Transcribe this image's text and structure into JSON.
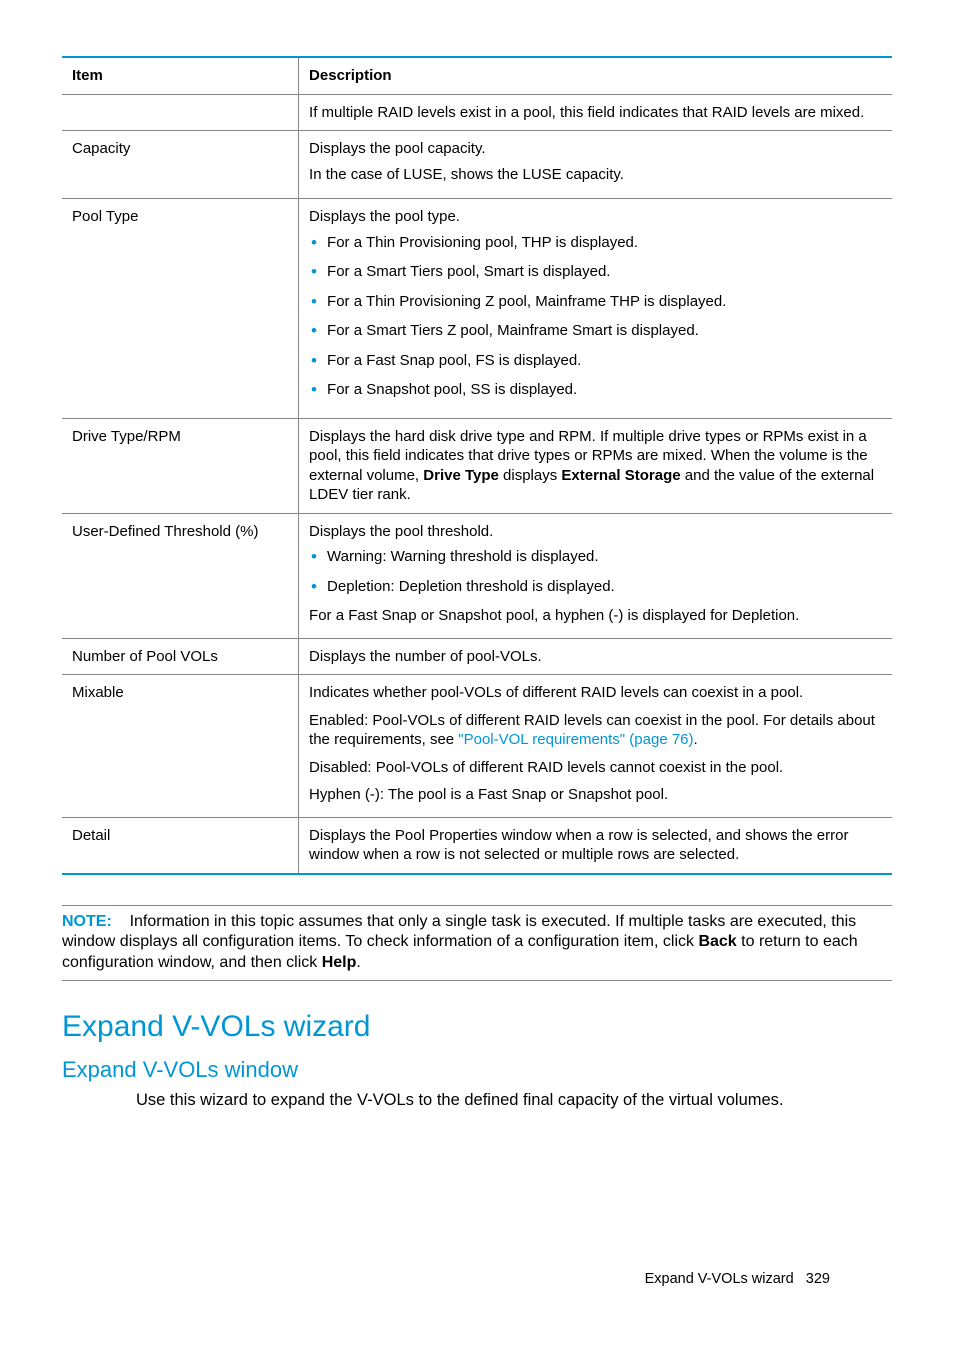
{
  "table": {
    "headers": {
      "item": "Item",
      "description": "Description"
    },
    "rows": {
      "raid_note": "If multiple RAID levels exist in a pool, this field indicates that RAID levels are mixed.",
      "capacity": {
        "item": "Capacity",
        "l1": "Displays the pool capacity.",
        "l2": "In the case of LUSE, shows the LUSE capacity."
      },
      "pool_type": {
        "item": "Pool Type",
        "lead": "Displays the pool type.",
        "bullets": [
          "For a Thin Provisioning pool, THP is displayed.",
          "For a Smart Tiers pool, Smart is displayed.",
          "For a Thin Provisioning Z pool, Mainframe THP is displayed.",
          "For a Smart Tiers Z pool, Mainframe Smart is displayed.",
          "For a Fast Snap pool, FS is displayed.",
          "For a Snapshot pool, SS is displayed."
        ]
      },
      "drive": {
        "item": "Drive Type/RPM",
        "t1": "Displays the hard disk drive type and RPM. If multiple drive types or RPMs exist in a pool, this field indicates that drive types or RPMs are mixed. When the volume is the external volume, ",
        "b1": "Drive Type",
        "t2": " displays ",
        "b2": "External Storage",
        "t3": " and the value of the external LDEV tier rank."
      },
      "threshold": {
        "item": "User-Defined Threshold (%)",
        "lead": "Displays the pool threshold.",
        "bullets": [
          "Warning: Warning threshold is displayed.",
          "Depletion: Depletion threshold is displayed."
        ],
        "trail": "For a Fast Snap or Snapshot pool, a hyphen (-) is displayed for Depletion."
      },
      "numvols": {
        "item": "Number of Pool VOLs",
        "desc": "Displays the number of pool-VOLs."
      },
      "mixable": {
        "item": "Mixable",
        "p1": "Indicates whether pool-VOLs of different RAID levels can coexist in a pool.",
        "p2a": "Enabled: Pool-VOLs of different RAID levels can coexist in the pool. For details about the requirements, see ",
        "link": "\"Pool-VOL requirements\" (page 76)",
        "p2b": ".",
        "p3": "Disabled: Pool-VOLs of different RAID levels cannot coexist in the pool.",
        "p4": "Hyphen (-): The pool is a Fast Snap or Snapshot pool."
      },
      "detail": {
        "item": "Detail",
        "desc": "Displays the Pool Properties window when a row is selected, and shows the error window when a row is not selected or multiple rows are selected."
      }
    }
  },
  "note": {
    "label": "NOTE:",
    "t1": "Information in this topic assumes that only a single task is executed. If multiple tasks are executed, this window displays all configuration items. To check information of a configuration item, click ",
    "b1": "Back",
    "t2": " to return to each configuration window, and then click ",
    "b2": "Help",
    "t3": "."
  },
  "section": {
    "h1": "Expand V-VOLs wizard",
    "h2": "Expand V-VOLs window",
    "body": "Use this wizard to expand the V-VOLs to the defined final capacity of the virtual volumes."
  },
  "footer": {
    "text": "Expand V-VOLs wizard",
    "page": "329"
  }
}
